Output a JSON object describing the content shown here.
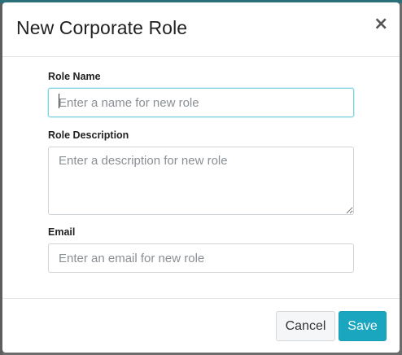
{
  "modal": {
    "title": "New Corporate Role",
    "close_symbol": "×"
  },
  "form": {
    "role_name": {
      "label": "Role Name",
      "placeholder": "Enter a name for new role",
      "value": ""
    },
    "role_description": {
      "label": "Role Description",
      "placeholder": "Enter a description for new role",
      "value": ""
    },
    "email": {
      "label": "Email",
      "placeholder": "Enter an email for new role",
      "value": ""
    }
  },
  "footer": {
    "cancel_label": "Cancel",
    "save_label": "Save"
  },
  "colors": {
    "accent": "#1aa6bf",
    "focus_border": "#7fd3e3",
    "overlay": "#6b6b6b"
  },
  "icons": {
    "close": "close-icon"
  }
}
